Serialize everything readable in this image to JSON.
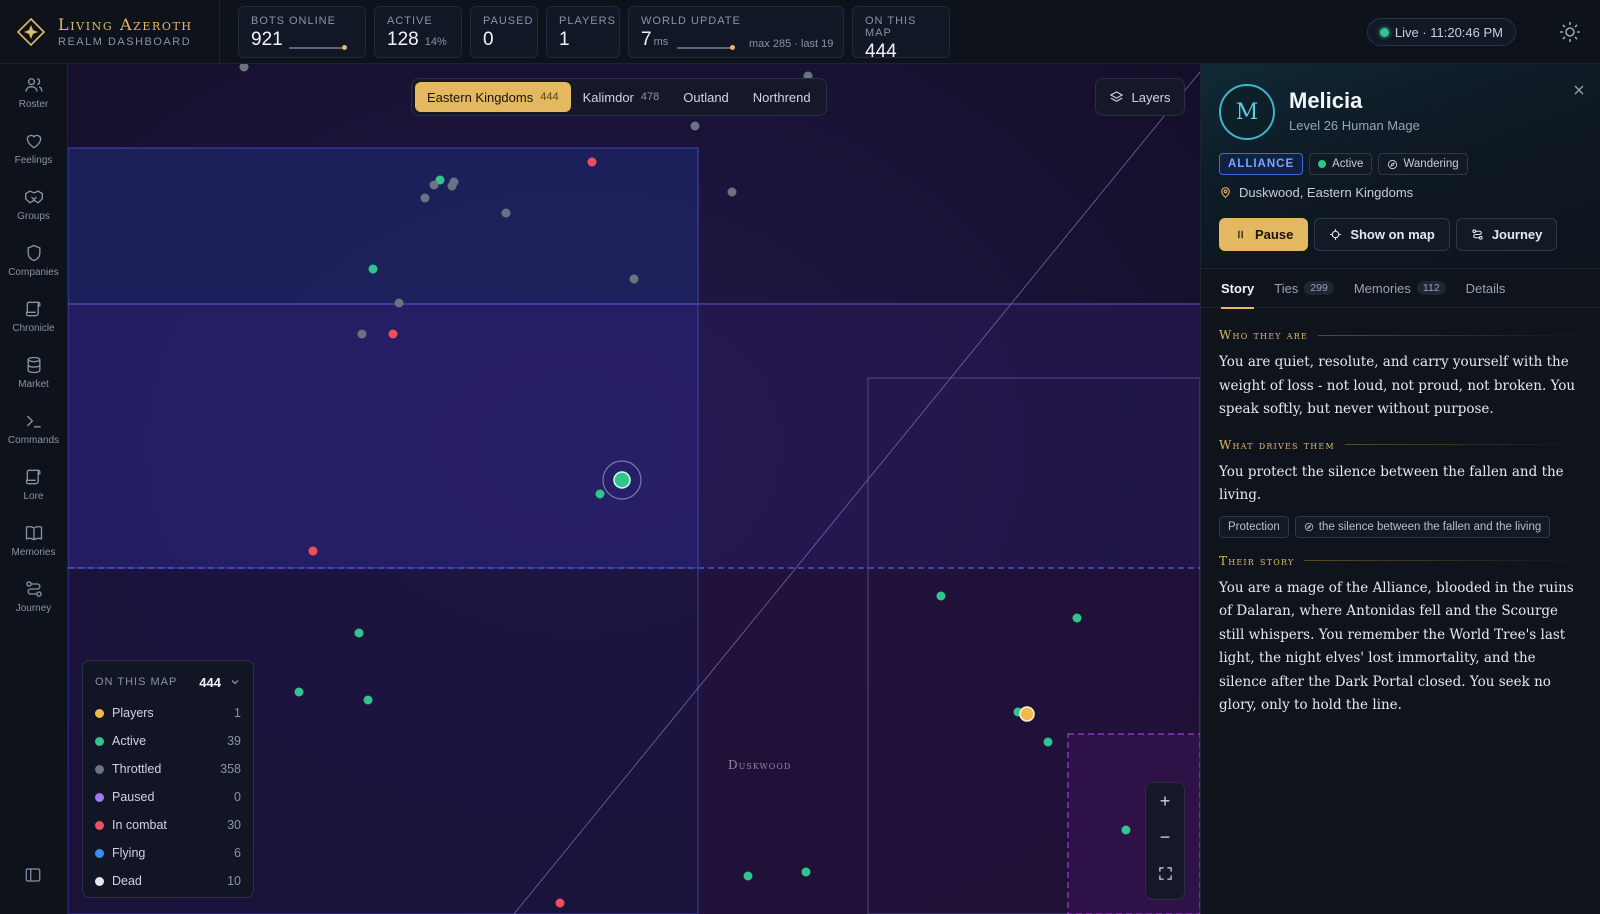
{
  "brand": {
    "title": "Living Azeroth",
    "subtitle": "REALM DASHBOARD"
  },
  "stats": {
    "bots_online": {
      "label": "BOTS ONLINE",
      "value": "921"
    },
    "active": {
      "label": "ACTIVE",
      "value": "128",
      "sub": "14%"
    },
    "paused": {
      "label": "PAUSED",
      "value": "0"
    },
    "players": {
      "label": "PLAYERS",
      "value": "1"
    },
    "world_update": {
      "label": "WORLD UPDATE",
      "value": "7",
      "unit": "ms",
      "sub": "max 285 · last 19"
    },
    "on_this_map": {
      "label": "ON THIS MAP",
      "value": "444"
    }
  },
  "live": {
    "text": "Live · 11:20:46 PM"
  },
  "nav": [
    {
      "label": "Roster",
      "icon": "users-icon"
    },
    {
      "label": "Feelings",
      "icon": "heart-icon"
    },
    {
      "label": "Groups",
      "icon": "handshake-icon"
    },
    {
      "label": "Companies",
      "icon": "shield-icon"
    },
    {
      "label": "Chronicle",
      "icon": "scroll-icon"
    },
    {
      "label": "Market",
      "icon": "database-icon"
    },
    {
      "label": "Commands",
      "icon": "terminal-icon"
    },
    {
      "label": "Lore",
      "icon": "scroll-icon"
    },
    {
      "label": "Memories",
      "icon": "book-icon"
    },
    {
      "label": "Journey",
      "icon": "route-icon"
    }
  ],
  "map": {
    "tabs": [
      {
        "label": "Eastern Kingdoms",
        "count": "444",
        "active": true
      },
      {
        "label": "Kalimdor",
        "count": "478",
        "active": false
      },
      {
        "label": "Outland",
        "count": "",
        "active": false
      },
      {
        "label": "Northrend",
        "count": "",
        "active": false
      }
    ],
    "layers_label": "Layers",
    "zone_label": "Duskwood",
    "zoom": {
      "in": "+",
      "out": "−"
    }
  },
  "legend": {
    "title": "ON THIS MAP",
    "total": "444",
    "items": [
      {
        "label": "Players",
        "count": "1",
        "color": "#f2b84b"
      },
      {
        "label": "Active",
        "count": "39",
        "color": "#31c48d"
      },
      {
        "label": "Throttled",
        "count": "358",
        "color": "#6b7280"
      },
      {
        "label": "Paused",
        "count": "0",
        "color": "#a078f0"
      },
      {
        "label": "In combat",
        "count": "30",
        "color": "#ef4f5a"
      },
      {
        "label": "Flying",
        "count": "6",
        "color": "#3b8ef0"
      },
      {
        "label": "Dead",
        "count": "10",
        "color": "#e5e7eb"
      }
    ]
  },
  "character": {
    "initial": "M",
    "name": "Melicia",
    "subtitle": "Level 26 Human Mage",
    "faction": "ALLIANCE",
    "status": "Active",
    "activity": "Wandering",
    "location": "Duskwood, Eastern Kingdoms",
    "buttons": {
      "pause": "Pause",
      "show_on_map": "Show on map",
      "journey": "Journey"
    },
    "tabs": [
      {
        "label": "Story",
        "count": "",
        "active": true
      },
      {
        "label": "Ties",
        "count": "299",
        "active": false
      },
      {
        "label": "Memories",
        "count": "112",
        "active": false
      },
      {
        "label": "Details",
        "count": "",
        "active": false
      }
    ],
    "story": {
      "who_title": "Who they are",
      "who_text": "You are quiet, resolute, and carry yourself with the weight of loss - not loud, not proud, not broken. You speak softly, but never without purpose.",
      "drives_title": "What drives them",
      "drives_text": "You protect the silence between the fallen and the living.",
      "drives_chips": [
        "Protection",
        "the silence between the fallen and the living"
      ],
      "story_title": "Their story",
      "story_text": "You are a mage of the Alliance, blooded in the ruins of Dalaran, where Antonidas fell and the Scourge still whispers. You remember the World Tree's last light, the night elves' lost immortality, and the silence after the Dark Portal closed. You seek no glory, only to hold the line."
    }
  },
  "colors": {
    "accent": "#e3b861",
    "active": "#31c48d",
    "throttled": "#6b7280",
    "combat": "#ef4f5a",
    "alliance": "#7ea3ff"
  }
}
